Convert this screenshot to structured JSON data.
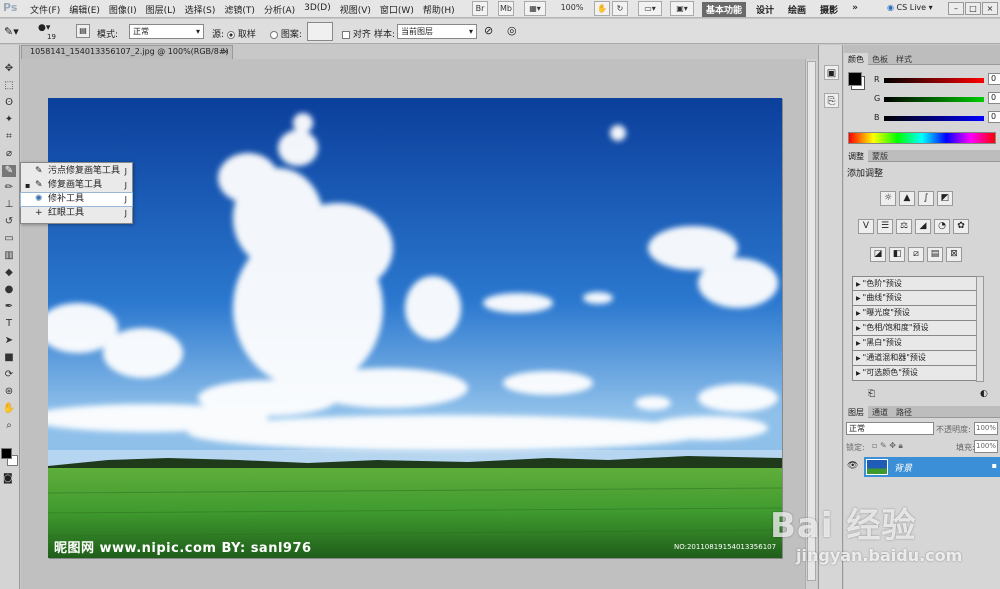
{
  "menubar": {
    "logo": "Ps",
    "items": [
      "文件(F)",
      "编辑(E)",
      "图像(I)",
      "图层(L)",
      "选择(S)",
      "滤镜(T)",
      "分析(A)",
      "3D(D)",
      "视图(V)",
      "窗口(W)",
      "帮助(H)"
    ],
    "zoom": "100%",
    "bridge": "Br",
    "minibridge": "Mb",
    "workspaces": [
      "基本功能",
      "设计",
      "绘画",
      "摄影"
    ],
    "more": "»",
    "cs_live": "CS Live",
    "window_controls": [
      "–",
      "□",
      "×"
    ]
  },
  "options_bar": {
    "brush_size": "19",
    "mode_label": "模式:",
    "mode_value": "正常",
    "source_label": "源:",
    "sample_label": "取样",
    "pattern_label": "图案:",
    "aligned_label": "对齐",
    "sample2_label": "样本:",
    "sample2_value": "当前图层"
  },
  "document": {
    "tab_title": "1058141_154013356107_2.jpg @ 100%(RGB/8#)",
    "close": "×",
    "watermark": "昵图网 www.nipic.com   BY: sanl976",
    "id_text": "NO:20110819154013356107"
  },
  "tool_flyout": {
    "items": [
      {
        "label": "污点修复画笔工具",
        "key": "J"
      },
      {
        "label": "修复画笔工具",
        "key": "J",
        "bullet": "▪"
      },
      {
        "label": "修补工具",
        "key": "J"
      },
      {
        "label": "红眼工具",
        "key": "J"
      }
    ]
  },
  "color_panel": {
    "tabs": [
      "颜色",
      "色板",
      "样式"
    ],
    "r_label": "R",
    "g_label": "G",
    "b_label": "B",
    "r_value": "0",
    "g_value": "0",
    "b_value": "0"
  },
  "adjust_panel": {
    "tabs": [
      "调整",
      "蒙版"
    ],
    "title": "添加调整",
    "presets": [
      "\"色阶\"预设",
      "\"曲线\"预设",
      "\"曝光度\"预设",
      "\"色相/饱和度\"预设",
      "\"黑白\"预设",
      "\"通道混和器\"预设",
      "\"可选颜色\"预设"
    ]
  },
  "layers_panel": {
    "tabs": [
      "图层",
      "通道",
      "路径"
    ],
    "blend_mode": "正常",
    "opacity_label": "不透明度:",
    "opacity_value": "100%",
    "lock_label": "锁定:",
    "fill_label": "填充:",
    "fill_value": "100%",
    "layer_name": "背景"
  },
  "baidu_watermark": {
    "logo": "Bai 经验",
    "url": "jingyan.baidu.com"
  },
  "colors": {
    "accent": "#3b8fd6",
    "sky_top": "#0b3f9c",
    "grass": "#3f9a2e"
  }
}
